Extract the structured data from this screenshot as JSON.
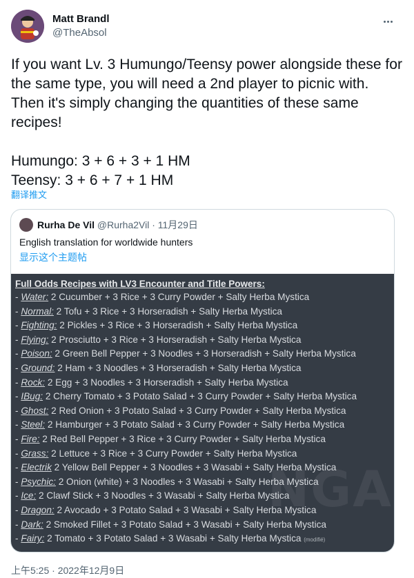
{
  "author": {
    "display_name": "Matt Brandl",
    "handle": "@TheAbsol"
  },
  "tweet": {
    "text": "If you want Lv. 3 Humungo/Teensy power alongside these for the same type, you will need a 2nd player to picnic with. Then it's simply changing the quantities of these same recipes!\n\nHumungo: 3 + 6 + 3 + 1 HM\nTeensy: 3 + 6 + 7 + 1 HM",
    "translate_label": "翻译推文",
    "timestamp": "上午5:25 · 2022年12月9日"
  },
  "quote": {
    "display_name": "Rurha De Vil",
    "meta": "@Rurha2Vil · 11月29日",
    "text": "English translation for worldwide hunters",
    "show_thread_label": "显示这个主题帖",
    "image": {
      "title": "Full Odds Recipes with LV3 Encounter and Title Powers:",
      "rows": [
        {
          "prefix": "- ",
          "type": "Water:",
          "recipe": " 2 Cucumber +  3 Rice + 3 Curry Powder + Salty Herba Mystica"
        },
        {
          "prefix": "- ",
          "type": "Normal:",
          "recipe": " 2 Tofu + 3 Rice + 3 Horseradish + Salty Herba Mystica"
        },
        {
          "prefix": "- ",
          "type": "Fighting:",
          "recipe": " 2 Pickles + 3 Rice + 3 Horseradish + Salty Herba Mystica"
        },
        {
          "prefix": "- ",
          "type": "Flying:",
          "recipe": " 2 Prosciutto + 3 Rice + 3 Horseradish + Salty Herba Mystica"
        },
        {
          "prefix": "- ",
          "type": "Poison:",
          "recipe": " 2 Green Bell Pepper +  3 Noodles + 3 Horseradish + Salty Herba Mystica"
        },
        {
          "prefix": "- ",
          "type": "Ground:",
          "recipe": " 2 Ham + 3 Noodles +  3 Horseradish + Salty Herba Mystica"
        },
        {
          "prefix": "- ",
          "type": "Rock:",
          "recipe": " 2 Egg + 3 Noodles +  3 Horseradish + Salty Herba Mystica"
        },
        {
          "prefix": "- ",
          "type": "IBug:",
          "recipe": " 2 Cherry Tomato + 3 Potato Salad + 3 Curry Powder + Salty Herba Mystica"
        },
        {
          "prefix": "- ",
          "type": "Ghost:",
          "recipe": " 2 Red Onion + 3 Potato Salad + 3 Curry Powder + Salty Herba Mystica"
        },
        {
          "prefix": "- ",
          "type": "Steel:",
          "recipe": " 2 Hamburger + 3 Potato Salad + 3 Curry Powder + Salty Herba Mystica"
        },
        {
          "prefix": "- ",
          "type": "Fire:",
          "recipe": " 2 Red Bell Pepper + 3 Rice  + 3 Curry Powder + Salty Herba Mystica"
        },
        {
          "prefix": "- ",
          "type": "Grass:",
          "recipe": " 2 Lettuce + 3 Rice + 3 Curry Powder + Salty Herba Mystica"
        },
        {
          "prefix": "- ",
          "type": "Electrik",
          "recipe": " 2 Yellow Bell Pepper + 3 Noodles + 3 Wasabi + Salty Herba Mystica"
        },
        {
          "prefix": "- ",
          "type": "Psychic:",
          "recipe": " 2 Onion (white) + 3 Noodles + 3 Wasabi + Salty Herba Mystica"
        },
        {
          "prefix": "- ",
          "type": "Ice:",
          "recipe": " 2 Clawf Stick + 3 Noodles + 3 Wasabi + Salty Herba Mystica"
        },
        {
          "prefix": "- ",
          "type": "Dragon:",
          "recipe": " 2 Avocado + 3 Potato Salad + 3 Wasabi + Salty Herba Mystica"
        },
        {
          "prefix": "- ",
          "type": "Dark:",
          "recipe": " 2 Smoked Fillet + 3 Potato Salad + 3 Wasabi + Salty Herba Mystica"
        },
        {
          "prefix": "- ",
          "type": "Fairy:",
          "recipe": " 2 Tomato + 3 Potato Salad + 3 Wasabi + Salty Herba Mystica",
          "note": "(modifié)"
        }
      ],
      "watermark": "NGA"
    }
  },
  "colors": {
    "link": "#1d9bf0",
    "secondary_text": "#536471",
    "image_background": "#353c45"
  }
}
